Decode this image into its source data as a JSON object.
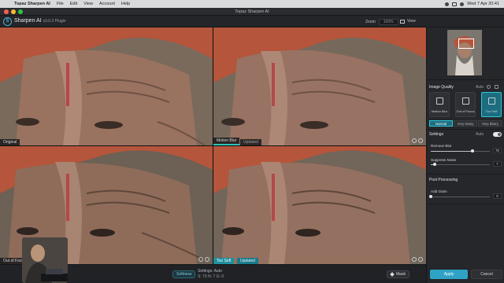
{
  "menubar": {
    "apple": "",
    "items": [
      "Topaz Sharpen AI",
      "File",
      "Edit",
      "View",
      "Account",
      "Help"
    ],
    "clock": "Wed 7 Apr  20:41"
  },
  "window": {
    "title": "Topaz Sharpen AI"
  },
  "header": {
    "logo_letter": "S",
    "app_name": "Sharpen AI",
    "version": "v3.0.2 Plugin",
    "zoom_label": "Zoom",
    "zoom_value": "100%",
    "view_label": "View"
  },
  "panes": {
    "top_left": {
      "label": "Original"
    },
    "top_right": {
      "label": "Motion Blur",
      "sub": "Updated"
    },
    "bottom_left": {
      "label": "Out of Focus"
    },
    "bottom_right": {
      "label": "Too Soft",
      "sub": "Updated"
    }
  },
  "bottombar": {
    "softness_label": "Softness",
    "settings_title": "Settings: Auto",
    "settings_values": "S: 70  N: 7  G: 0",
    "mask_label": "Mask"
  },
  "side": {
    "image_quality_title": "Image Quality",
    "auto_label": "Auto",
    "modes": [
      {
        "label": "Motion Blur"
      },
      {
        "label": "Out of Focus"
      },
      {
        "label": "Too Soft"
      }
    ],
    "levels": [
      "Normal",
      "Very Noisy",
      "Very Blurry"
    ],
    "settings_title": "Settings",
    "remove_blur_label": "Remove Blur",
    "remove_blur_value": "70",
    "suppress_noise_label": "Suppress Noise",
    "suppress_noise_value": "7",
    "post_processing_title": "Post Processing",
    "add_grain_label": "Add Grain",
    "add_grain_value": "0",
    "apply_label": "Apply",
    "cancel_label": "Cancel"
  },
  "values": {
    "remove_blur_fraction": 0.7,
    "suppress_noise_fraction": 0.07,
    "add_grain_fraction": 0.0
  },
  "colors": {
    "accent": "#2ec5d8",
    "apply": "#2fa3c6",
    "selected_tab": "#1f8f9e"
  }
}
